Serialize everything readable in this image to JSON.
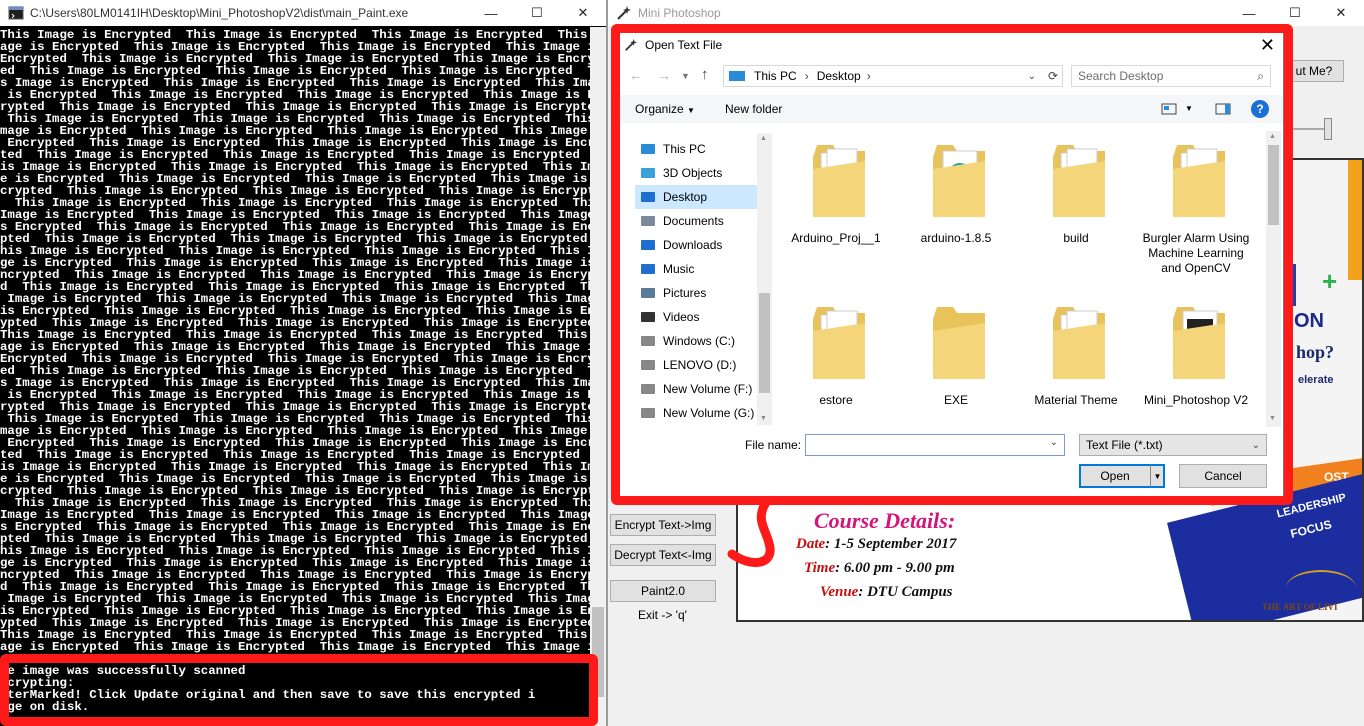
{
  "console": {
    "title": "C:\\Users\\80LM0141IH\\Desktop\\Mini_PhotoshopV2\\dist\\main_Paint.exe",
    "repeat_phrase": "This Image is Encrypted  ",
    "status": [
      "he image was successfully scanned",
      "ncrypting:",
      "aterMarked! Click Update original and then save to save this encrypted i",
      "age on disk."
    ]
  },
  "window_controls": {
    "minimize": "—",
    "maximize": "☐",
    "close": "✕"
  },
  "mini_photoshop": {
    "title": "Mini Photoshop",
    "about_button": "ut Me?",
    "buttons": {
      "encrypt": "Encrypt Text->Img",
      "decrypt": "Decrypt Text<-Img",
      "paint": "Paint2.0"
    },
    "exit_hint": "Exit -> 'q'",
    "poster": {
      "course_details": "Course Details:",
      "date": {
        "label": "Date",
        "value": ": 1-5 September 2017"
      },
      "time": {
        "label": "Time",
        "value": ": 6.00 pm - 9.00 pm"
      },
      "venue": {
        "label": "Venue",
        "value": ": DTU Campus"
      },
      "fragments": [
        "ON",
        "hop?",
        "elerate",
        "OST",
        "LEADERSHIP",
        "FOCUS",
        "THE ART OF LIVI"
      ]
    }
  },
  "dialog": {
    "title": "Open Text File",
    "breadcrumb": [
      "This PC",
      "Desktop"
    ],
    "search_placeholder": "Search Desktop",
    "organize": "Organize",
    "new_folder": "New folder",
    "nav": [
      {
        "label": "This PC",
        "icon": "monitor-icon"
      },
      {
        "label": "3D Objects",
        "icon": "cube-icon"
      },
      {
        "label": "Desktop",
        "icon": "desktop-icon",
        "selected": true
      },
      {
        "label": "Documents",
        "icon": "document-icon"
      },
      {
        "label": "Downloads",
        "icon": "download-arrow-icon"
      },
      {
        "label": "Music",
        "icon": "music-note-icon"
      },
      {
        "label": "Pictures",
        "icon": "picture-icon"
      },
      {
        "label": "Videos",
        "icon": "film-icon"
      },
      {
        "label": "Windows (C:)",
        "icon": "drive-icon"
      },
      {
        "label": "LENOVO (D:)",
        "icon": "drive-icon"
      },
      {
        "label": "New Volume (F:)",
        "icon": "drive-icon"
      },
      {
        "label": "New Volume (G:)",
        "icon": "drive-icon"
      }
    ],
    "files": [
      {
        "name": "Arduino_Proj__1",
        "kind": "docs"
      },
      {
        "name": "arduino-1.8.5",
        "kind": "arduino"
      },
      {
        "name": "build",
        "kind": "docs"
      },
      {
        "name": "Burgler Alarm Using Machine Learning and OpenCV",
        "kind": "docs"
      },
      {
        "name": "estore",
        "kind": "docs"
      },
      {
        "name": "EXE",
        "kind": "plain"
      },
      {
        "name": "Material Theme",
        "kind": "docs"
      },
      {
        "name": "Mini_Photoshop V2",
        "kind": "image"
      }
    ],
    "file_name_label": "File name:",
    "file_name_value": "",
    "file_type": "Text File (*.txt)",
    "open": "Open",
    "cancel": "Cancel"
  },
  "colors": {
    "highlight": "#ff1a1a",
    "selection": "#cce8ff",
    "poster_magenta": "#d4147a",
    "poster_red": "#c41010"
  }
}
